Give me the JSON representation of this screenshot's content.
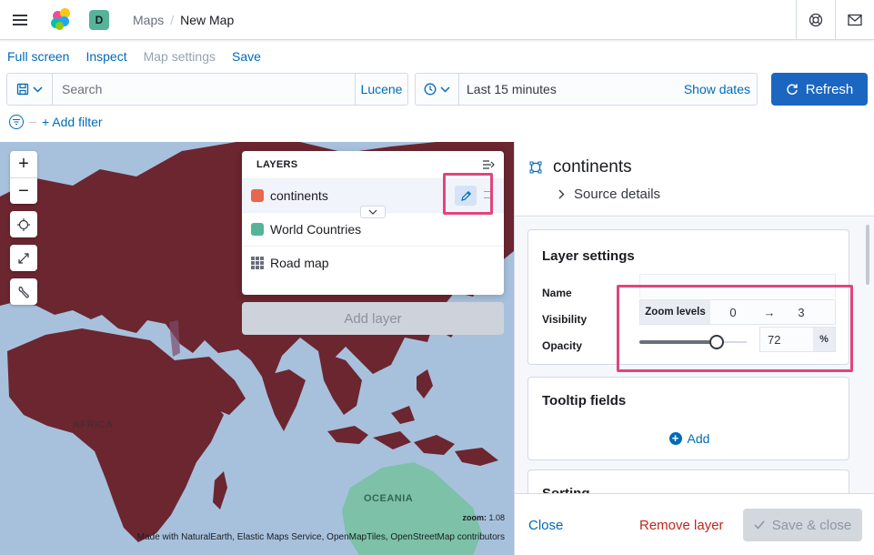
{
  "header": {
    "space_letter": "D",
    "breadcrumbs": [
      "Maps",
      "New Map"
    ]
  },
  "app_menu": {
    "items": [
      "Full screen",
      "Inspect",
      "Map settings",
      "Save"
    ]
  },
  "query_bar": {
    "search_placeholder": "Search",
    "language": "Lucene",
    "time_range": "Last 15 minutes",
    "show_dates": "Show dates",
    "refresh": "Refresh"
  },
  "filters": {
    "add_filter": "+ Add filter"
  },
  "map": {
    "labels": [
      "AFRICA",
      "OCEANIA"
    ],
    "zoom_label": "zoom:",
    "zoom_value": "1.08",
    "attribution": "Made with NaturalEarth, Elastic Maps Service, OpenMapTiles, OpenStreetMap contributors"
  },
  "layers_panel": {
    "title": "LAYERS",
    "layers": [
      {
        "name": "continents",
        "color": "#e7664c"
      },
      {
        "name": "World Countries",
        "color": "#54b399"
      },
      {
        "name": "Road map",
        "icon": "grid-icon"
      }
    ],
    "add_layer": "Add layer"
  },
  "layer_editor": {
    "title": "continents",
    "source_details": "Source details",
    "layer_settings": {
      "title": "Layer settings",
      "name_label": "Name",
      "name_value": "",
      "visibility_label": "Visibility",
      "zoom_levels_label": "Zoom levels",
      "zoom_min": "0",
      "zoom_arrow": "→",
      "zoom_max": "3",
      "opacity_label": "Opacity",
      "opacity_value": "72",
      "opacity_unit": "%"
    },
    "tooltip_fields": {
      "title": "Tooltip fields",
      "add": "Add"
    },
    "sorting": {
      "title": "Sorting"
    },
    "footer": {
      "close": "Close",
      "remove": "Remove layer",
      "save_close": "Save & close"
    }
  },
  "colors": {
    "accent": "#006bb8",
    "land": "#6b2630",
    "ocean": "#a7c1dd",
    "highlight": "#e0457b"
  }
}
